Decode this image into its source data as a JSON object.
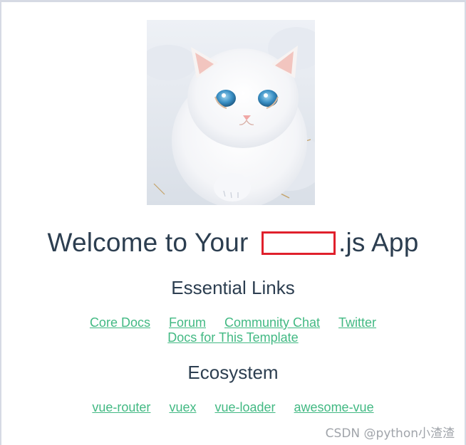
{
  "app": {
    "title_before": "Welcome to Your ",
    "title_after": ".js App",
    "redaction_color": "#e0202c"
  },
  "hero_image": {
    "subject": "white kitten walking on snow",
    "icon": "cat-photo"
  },
  "essential": {
    "heading": "Essential Links",
    "links": [
      "Core Docs",
      "Forum",
      "Community Chat",
      "Twitter",
      "Docs for This Template"
    ]
  },
  "ecosystem": {
    "heading": "Ecosystem",
    "links": [
      "vue-router",
      "vuex",
      "vue-loader",
      "awesome-vue"
    ]
  },
  "colors": {
    "text": "#2c3e50",
    "link": "#42b983"
  },
  "watermark": "CSDN @python小渣渣"
}
